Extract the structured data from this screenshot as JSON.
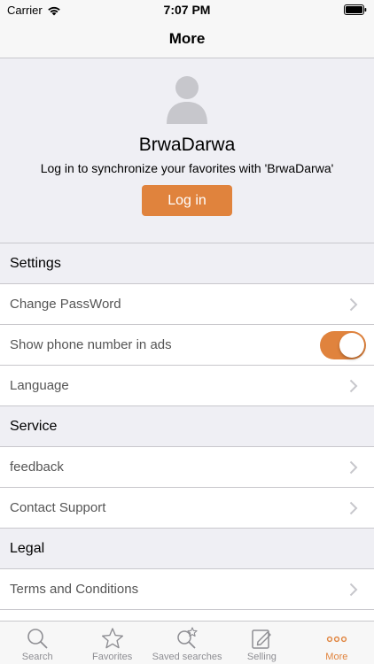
{
  "status_bar": {
    "carrier": "Carrier",
    "time": "7:07 PM"
  },
  "nav": {
    "title": "More"
  },
  "profile": {
    "name": "BrwaDarwa",
    "sync_message": "Log in to synchronize your favorites with 'BrwaDarwa'",
    "login_label": "Log in"
  },
  "sections": {
    "settings": {
      "title": "Settings",
      "change_password": "Change PassWord",
      "show_phone": "Show phone number in ads",
      "show_phone_on": true,
      "language": "Language"
    },
    "service": {
      "title": "Service",
      "feedback": "feedback",
      "contact_support": "Contact Support"
    },
    "legal": {
      "title": "Legal",
      "terms": "Terms and Conditions"
    }
  },
  "tabbar": {
    "items": [
      {
        "label": "Search",
        "icon": "search-icon"
      },
      {
        "label": "Favorites",
        "icon": "star-icon"
      },
      {
        "label": "Saved searches",
        "icon": "saved-search-icon"
      },
      {
        "label": "Selling",
        "icon": "edit-icon"
      },
      {
        "label": "More",
        "icon": "more-icon"
      }
    ],
    "active_index": 4
  },
  "colors": {
    "accent": "#e0833d",
    "background": "#efeff4",
    "separator": "#c8c7cc"
  }
}
